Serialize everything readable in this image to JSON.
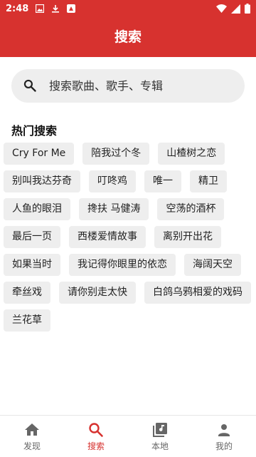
{
  "status_bar": {
    "time": "2:48"
  },
  "header": {
    "title": "搜索"
  },
  "search": {
    "placeholder": "搜索歌曲、歌手、专辑"
  },
  "hot_search": {
    "title": "热门搜索",
    "tags": [
      "Cry For Me",
      "陪我过个冬",
      "山楂树之恋",
      "别叫我达芬奇",
      "叮咚鸡",
      "唯一",
      "精卫",
      "人鱼的眼泪",
      "搀扶 马健涛",
      "空荡的酒杯",
      "最后一页",
      "西楼爱情故事",
      "离别开出花",
      "如果当时",
      "我记得你眼里的依恋",
      "海阔天空",
      "牵丝戏",
      "请你别走太快",
      "白鸽乌鸦相爱的戏码",
      "兰花草"
    ]
  },
  "bottom_nav": {
    "items": [
      {
        "label": "发现",
        "icon": "home-icon",
        "active": false
      },
      {
        "label": "搜索",
        "icon": "search-icon",
        "active": true
      },
      {
        "label": "本地",
        "icon": "music-library-icon",
        "active": false
      },
      {
        "label": "我的",
        "icon": "person-icon",
        "active": false
      }
    ]
  },
  "colors": {
    "accent": "#d7322f",
    "inactive": "#666666",
    "chip_bg": "#eeeeee"
  }
}
